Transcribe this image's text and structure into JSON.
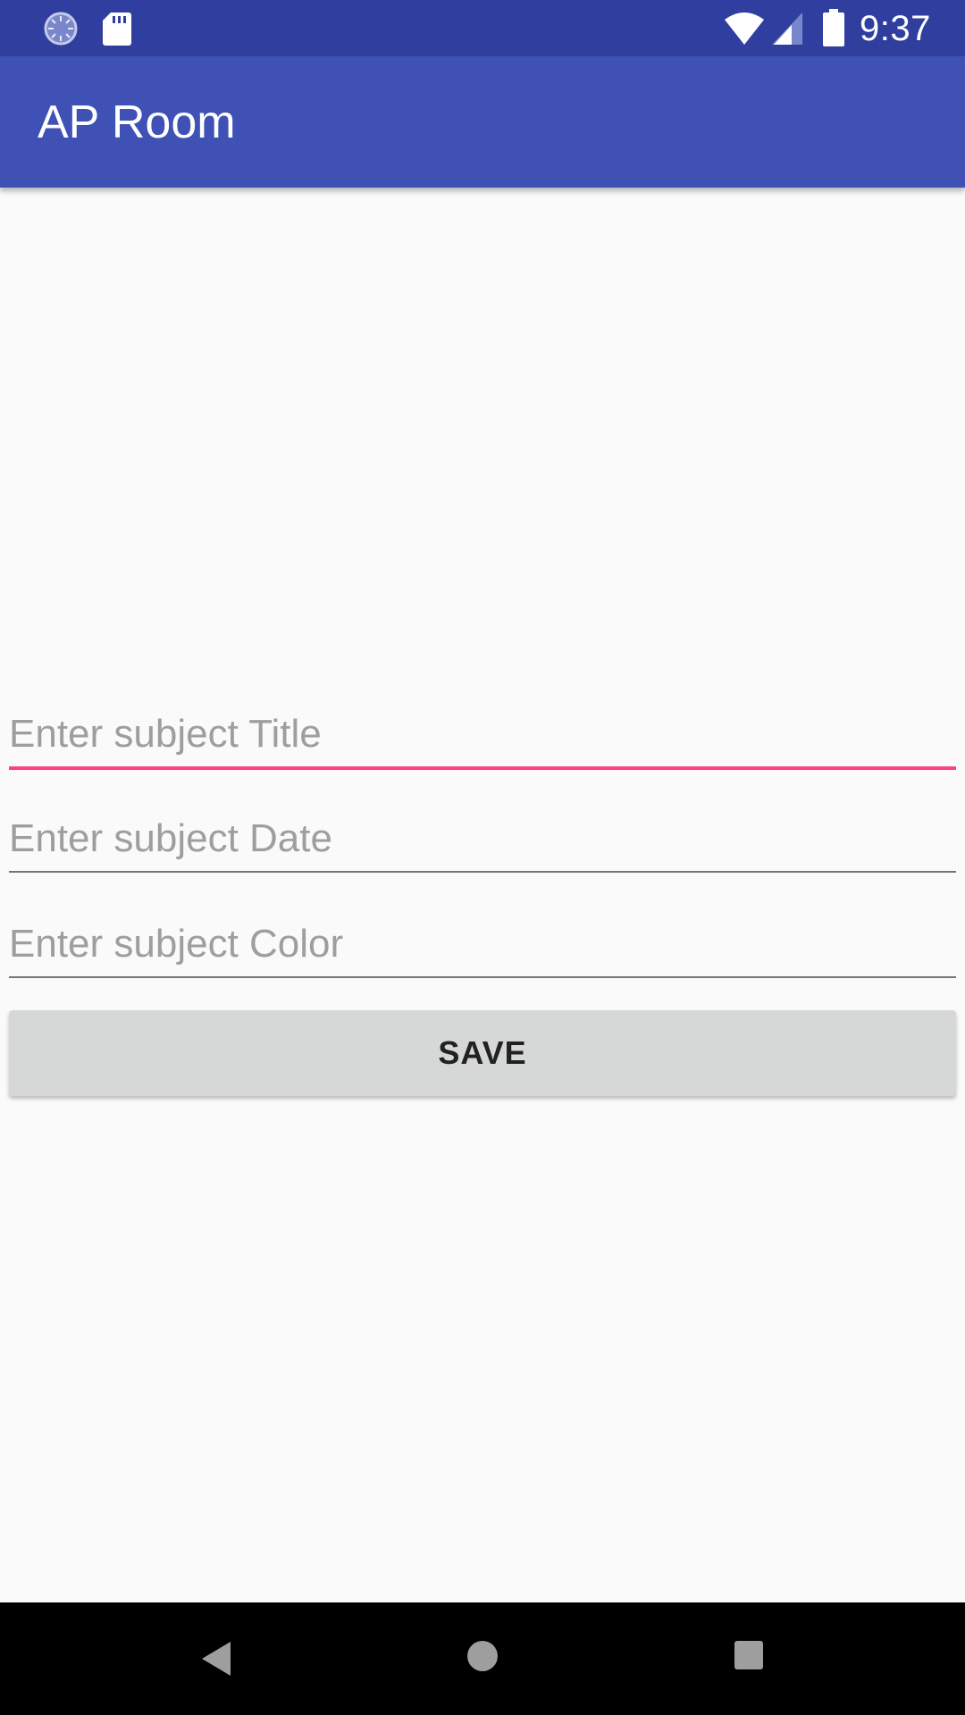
{
  "status_bar": {
    "time": "9:37",
    "icons": [
      "loading-icon",
      "sdcard-icon",
      "wifi-icon",
      "signal-icon",
      "battery-icon"
    ]
  },
  "app_bar": {
    "title": "AP Room",
    "color": "#3f51b5"
  },
  "form": {
    "title_field": {
      "placeholder": "Enter subject Title",
      "value": ""
    },
    "date_field": {
      "placeholder": "Enter subject Date",
      "value": ""
    },
    "color_field": {
      "placeholder": "Enter subject Color",
      "value": ""
    },
    "save_label": "SAVE",
    "accent_color": "#ff4081"
  },
  "nav_bar": {
    "icons": [
      "back-icon",
      "home-icon",
      "recents-icon"
    ]
  }
}
